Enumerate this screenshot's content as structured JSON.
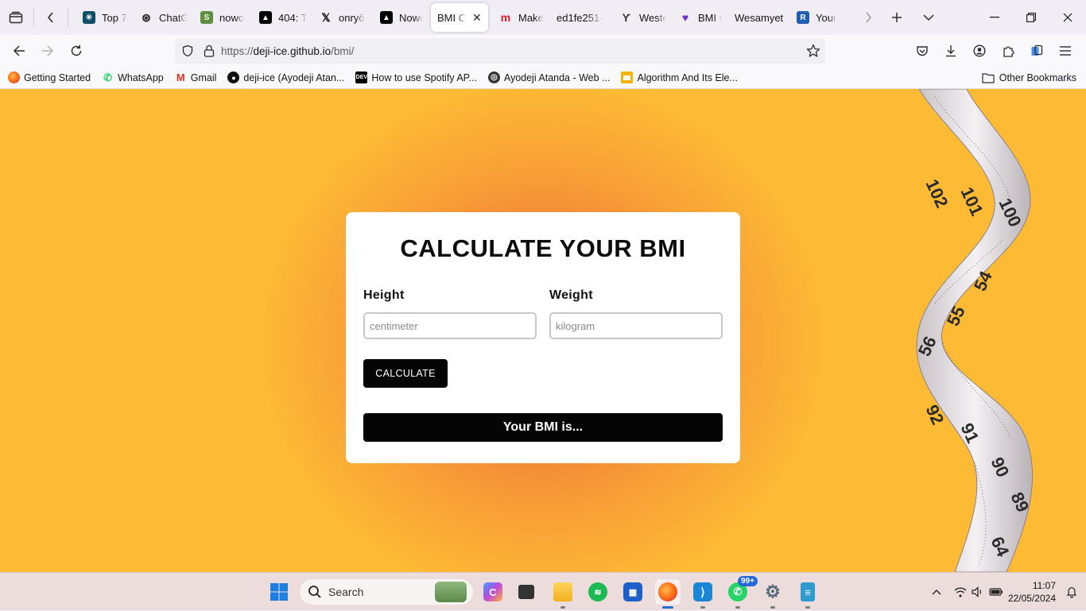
{
  "browser": {
    "tabs": [
      {
        "label": "Top 7",
        "icon": "react-icon",
        "color": "#0b4e66"
      },
      {
        "label": "ChatG",
        "icon": "openai-icon",
        "color": "#222222"
      },
      {
        "label": "nowo",
        "icon": "shopify-icon",
        "color": "#5e8e3e"
      },
      {
        "label": "404: T",
        "icon": "vercel-icon",
        "color": "#000000"
      },
      {
        "label": "onryō",
        "icon": "x-icon",
        "color": "#000000"
      },
      {
        "label": "Nowo",
        "icon": "vercel-icon",
        "color": "#000000"
      },
      {
        "label": "BMI Ca",
        "icon": "",
        "color": "#ffffff",
        "active": true
      },
      {
        "label": "Make",
        "icon": "make-icon",
        "color": "#e0202b"
      },
      {
        "label": "ed1fe251-",
        "icon": "",
        "color": "#ffffff"
      },
      {
        "label": "Weste",
        "icon": "western-icon",
        "color": "#333333"
      },
      {
        "label": "BMI C",
        "icon": "heart-icon",
        "color": "#6b2fd0"
      },
      {
        "label": "Wesamyet",
        "icon": "",
        "color": "#ffffff"
      },
      {
        "label": "Your",
        "icon": "r-icon",
        "color": "#1e5fb4"
      }
    ],
    "url_prefix": "https://",
    "url_domain": "deji-ice.github.io",
    "url_path": "/bmi/",
    "bookmarks": [
      {
        "label": "Getting Started",
        "icon": "firefox-icon",
        "color": "#e66000"
      },
      {
        "label": "WhatsApp",
        "icon": "whatsapp-icon",
        "color": "#25d366"
      },
      {
        "label": "Gmail",
        "icon": "gmail-icon",
        "color": "#d93025"
      },
      {
        "label": "deji-ice (Ayodeji Atan...",
        "icon": "github-icon",
        "color": "#111111"
      },
      {
        "label": "How to use Spotify AP...",
        "icon": "dev-icon",
        "color": "#000000"
      },
      {
        "label": "Ayodeji Atanda - Web ...",
        "icon": "web-icon",
        "color": "#333333"
      },
      {
        "label": "Algorithm And Its Ele...",
        "icon": "slides-icon",
        "color": "#f4b400"
      }
    ],
    "other_bookmarks": "Other Bookmarks"
  },
  "page": {
    "heading": "CALCULATE YOUR BMI",
    "height_label": "Height",
    "height_placeholder": "centimeter",
    "weight_label": "Weight",
    "weight_placeholder": "kilogram",
    "calculate_label": "CALCULATE",
    "result_text": "Your BMI is...",
    "tape_numbers": [
      "102",
      "101",
      "100",
      "54",
      "55",
      "56",
      "92",
      "91",
      "90",
      "89",
      "64"
    ],
    "background_color": "#fdbb35",
    "glow_color": "#ee6a35"
  },
  "taskbar": {
    "search_placeholder": "Search",
    "whatsapp_badge": "99+",
    "time": "11:07",
    "date": "22/05/2024"
  }
}
